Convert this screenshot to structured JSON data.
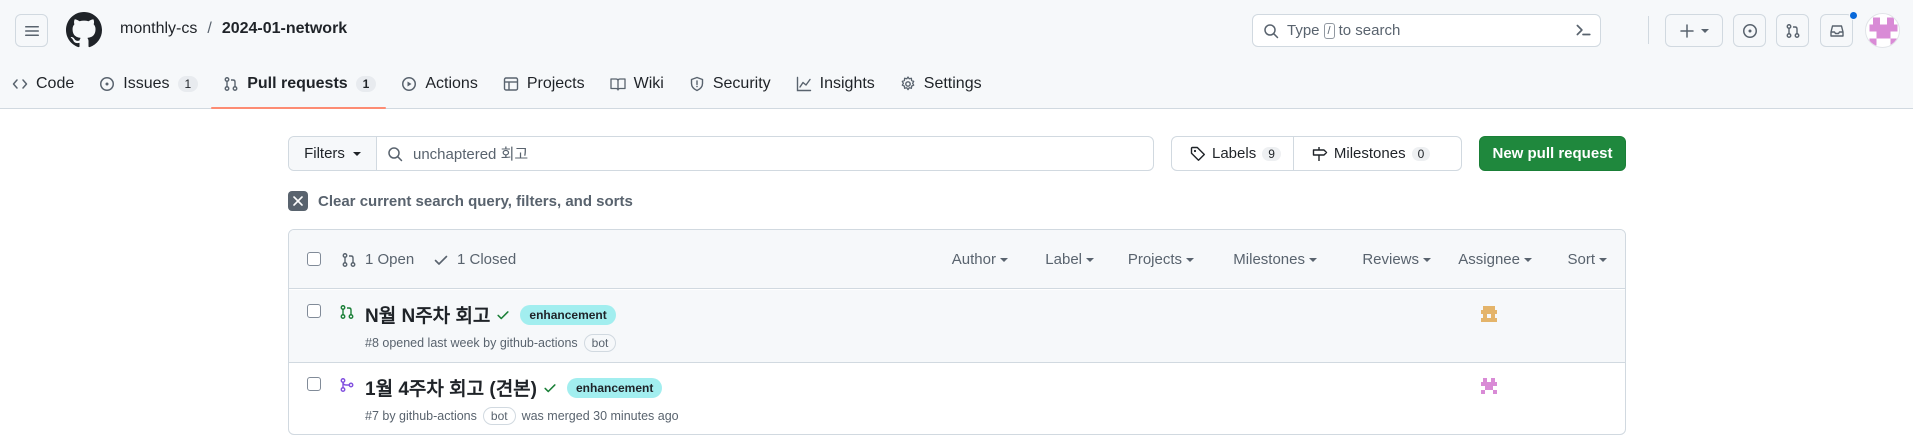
{
  "header": {
    "owner": "monthly-cs",
    "separator": "/",
    "repo": "2024-01-network",
    "search": {
      "prefix": "Type",
      "key": "/",
      "suffix": "to search"
    }
  },
  "tabs": [
    {
      "label": "Code",
      "icon": "code-icon"
    },
    {
      "label": "Issues",
      "count": "1",
      "icon": "issue-opened-icon"
    },
    {
      "label": "Pull requests",
      "count": "1",
      "icon": "git-pull-request-icon",
      "active": true
    },
    {
      "label": "Actions",
      "icon": "play-icon"
    },
    {
      "label": "Projects",
      "icon": "table-icon"
    },
    {
      "label": "Wiki",
      "icon": "book-icon"
    },
    {
      "label": "Security",
      "icon": "shield-icon"
    },
    {
      "label": "Insights",
      "icon": "graph-icon"
    },
    {
      "label": "Settings",
      "icon": "gear-icon"
    }
  ],
  "toolbar": {
    "filters_label": "Filters",
    "query": "unchaptered 회고",
    "labels_label": "Labels",
    "labels_count": "9",
    "milestones_label": "Milestones",
    "milestones_count": "0",
    "new_pr_label": "New pull request"
  },
  "clear_text": "Clear current search query, filters, and sorts",
  "list_header": {
    "open_label": "1 Open",
    "closed_label": "1 Closed",
    "filters": [
      "Author",
      "Label",
      "Projects",
      "Milestones",
      "Reviews",
      "Assignee",
      "Sort"
    ]
  },
  "pull_requests": [
    {
      "title": "N월 N주차 회고",
      "label": "enhancement",
      "meta_prefix": "#8 opened last week by github-actions",
      "bot": "bot",
      "meta_suffix": "",
      "state": "open"
    },
    {
      "title": "1월 4주차 회고 (견본)",
      "label": "enhancement",
      "meta_prefix": "#7 by github-actions",
      "bot": "bot",
      "meta_suffix": "was merged 30 minutes ago",
      "state": "merged"
    }
  ],
  "colors": {
    "open": "#1a7f37",
    "merged": "#8250df",
    "label_bg": "#a2eeef",
    "primary": "#1f883d",
    "tab_underline": "#fd8c73"
  }
}
